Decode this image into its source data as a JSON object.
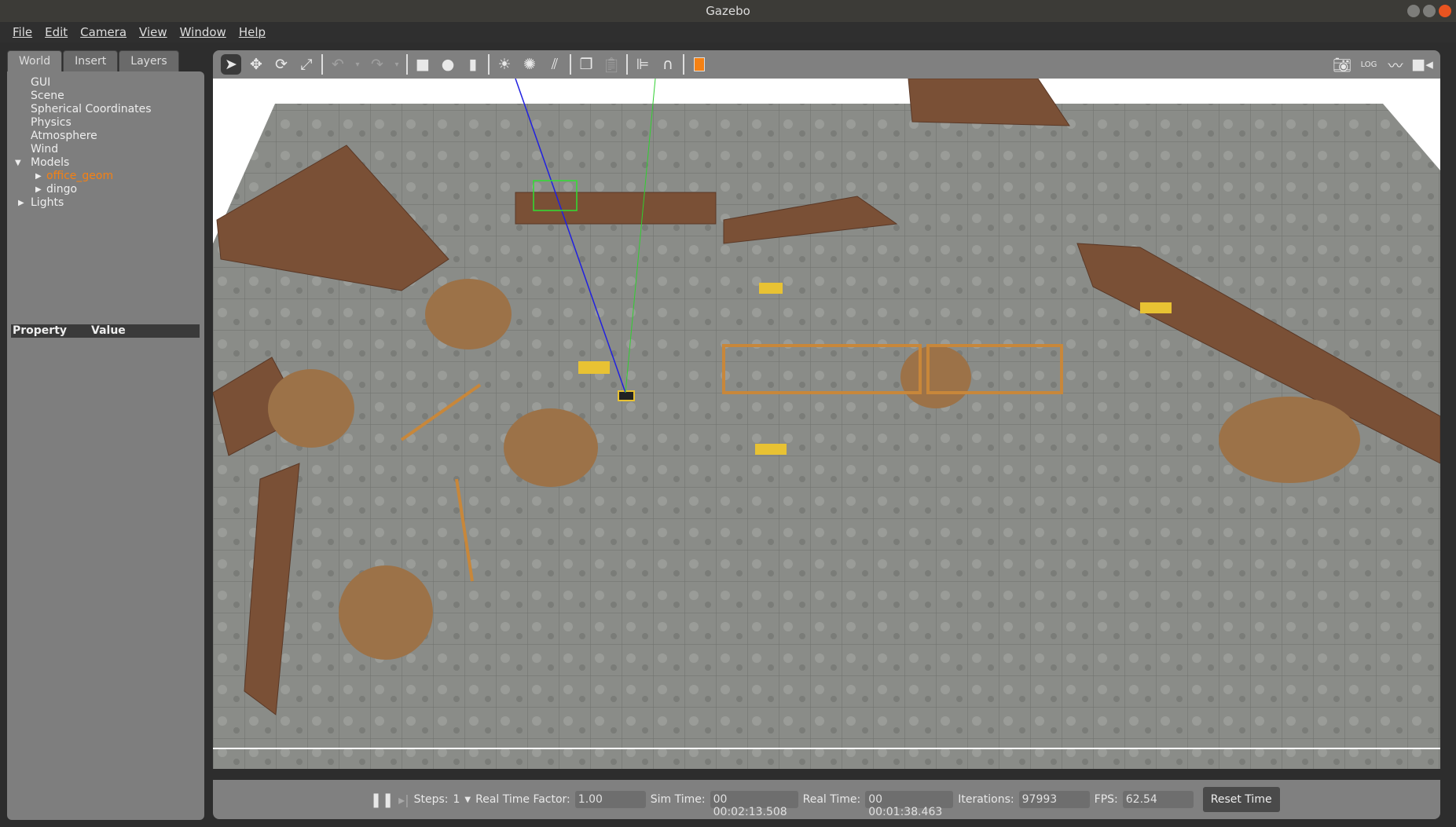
{
  "window": {
    "title": "Gazebo"
  },
  "menu": [
    "File",
    "Edit",
    "Camera",
    "View",
    "Window",
    "Help"
  ],
  "left_panel": {
    "tabs": [
      "World",
      "Insert",
      "Layers"
    ],
    "active_tab": "World",
    "tree": [
      {
        "label": "GUI"
      },
      {
        "label": "Scene"
      },
      {
        "label": "Spherical Coordinates"
      },
      {
        "label": "Physics"
      },
      {
        "label": "Atmosphere"
      },
      {
        "label": "Wind"
      },
      {
        "label": "Models",
        "expanded": true,
        "children": [
          {
            "label": "office_geom",
            "selected": true
          },
          {
            "label": "dingo"
          }
        ]
      },
      {
        "label": "Lights"
      }
    ],
    "property_header": {
      "property": "Property",
      "value": "Value"
    }
  },
  "toolbar": {
    "left_icons": [
      "select-arrow-icon",
      "translate-icon",
      "rotate-icon",
      "scale-icon",
      "undo-icon",
      "undo-dropdown-icon",
      "redo-icon",
      "redo-dropdown-icon",
      "box-icon",
      "sphere-icon",
      "cylinder-icon",
      "point-light-icon",
      "spot-light-icon",
      "directional-light-icon",
      "copy-icon",
      "paste-icon",
      "align-icon",
      "snap-magnet-icon",
      "view-angle-icon"
    ],
    "right_icons": [
      "screenshot-camera-icon",
      "log-icon",
      "plot-icon",
      "video-record-icon"
    ],
    "accent": "#f58113"
  },
  "bottom_bar": {
    "steps_label": "Steps:",
    "steps_value": "1",
    "rtf_label": "Real Time Factor:",
    "rtf_value": "1.00",
    "sim_time_label": "Sim Time:",
    "sim_time_value": "00 00:02:13.508",
    "real_time_label": "Real Time:",
    "real_time_value": "00 00:01:38.463",
    "iterations_label": "Iterations:",
    "iterations_value": "97993",
    "fps_label": "FPS:",
    "fps_value": "62.54",
    "reset_label": "Reset Time"
  }
}
